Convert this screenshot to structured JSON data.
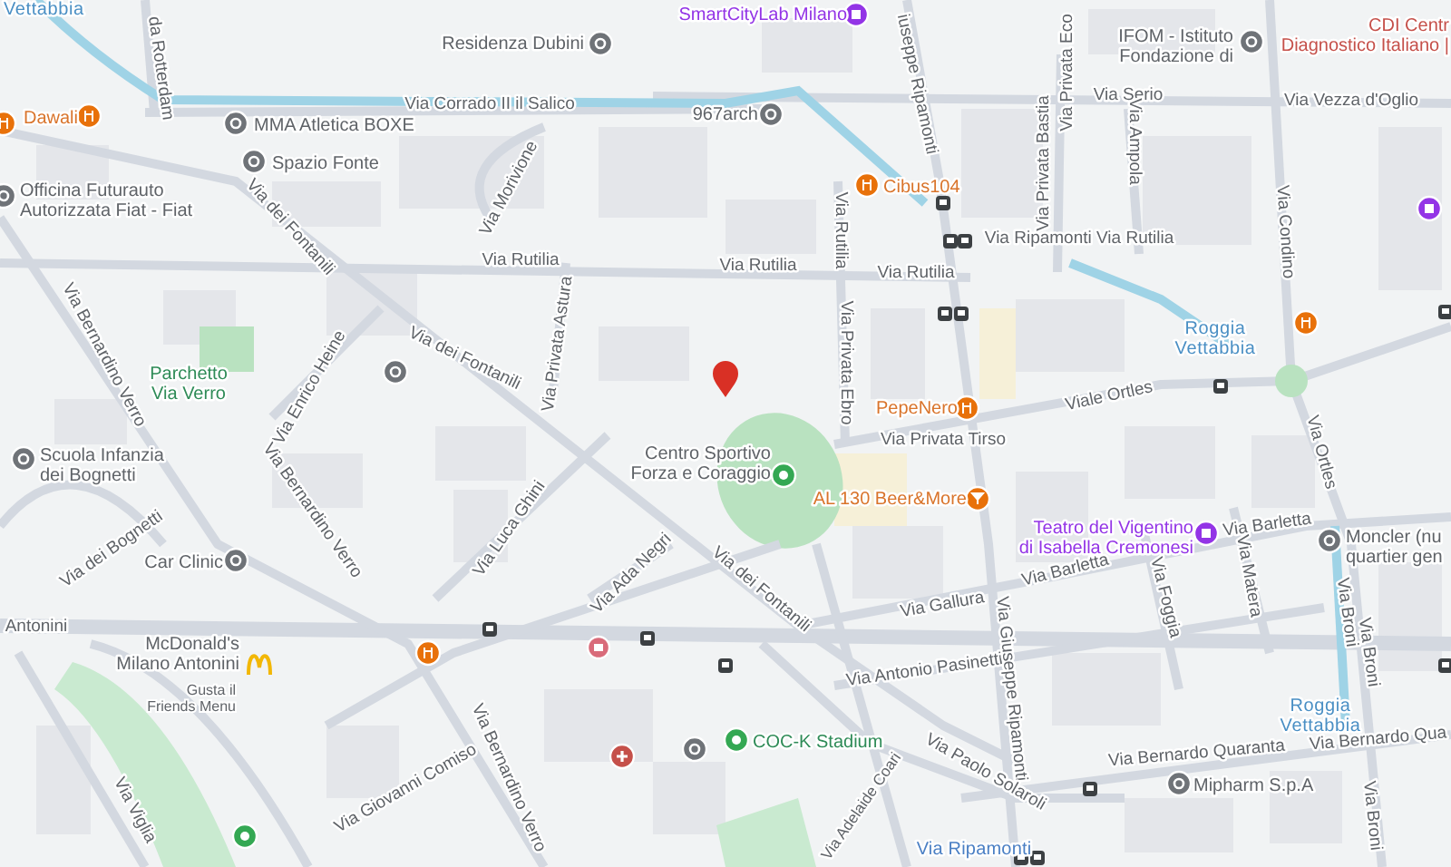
{
  "streets": [
    {
      "name": "da Rotterdam"
    },
    {
      "name": "Via Corrado II il Salico"
    },
    {
      "name": "Via Serio"
    },
    {
      "name": "Via Vezza d'Oglio"
    },
    {
      "name": "iuseppe Ripamonti"
    },
    {
      "name": "Via Privata Eco"
    },
    {
      "name": "Via Privata Bastia"
    },
    {
      "name": "Via Ampola"
    },
    {
      "name": "Via Condino"
    },
    {
      "name": "Via Morivione"
    },
    {
      "name": "Via dei Fontanili"
    },
    {
      "name": "Via Rutilia"
    },
    {
      "name": "Via Rutilia"
    },
    {
      "name": "Via Rutilia"
    },
    {
      "name": "Via Rutilia"
    },
    {
      "name": "Via Ripamonti Via Rutilia"
    },
    {
      "name": "Via Privata Astura"
    },
    {
      "name": "Via Privata Ebro"
    },
    {
      "name": "Via dei Fontanili"
    },
    {
      "name": "Via Bernardino Verro"
    },
    {
      "name": "Via Enrico Heine"
    },
    {
      "name": "Viale Ortles"
    },
    {
      "name": "Via Privata Tirso"
    },
    {
      "name": "Via Ortles"
    },
    {
      "name": "Via dei Bognetti"
    },
    {
      "name": "Via Bernardino Verro"
    },
    {
      "name": "Via Luca Ghini"
    },
    {
      "name": "Via Ada Negri"
    },
    {
      "name": "Via dei Fontanili"
    },
    {
      "name": "Via Gallura"
    },
    {
      "name": "Via Barletta"
    },
    {
      "name": "Via Barletta"
    },
    {
      "name": "Via Foggia"
    },
    {
      "name": "Via Matera"
    },
    {
      "name": "Via Broni"
    },
    {
      "name": "Via Broni"
    },
    {
      "name": "Antonini"
    },
    {
      "name": "Via Antonio Pasinetti"
    },
    {
      "name": "Via Giuseppe Ripamonti"
    },
    {
      "name": "Via Giovanni Comiso"
    },
    {
      "name": "Via Bernardino Verro"
    },
    {
      "name": "Via Paolo Solaroli"
    },
    {
      "name": "Via Bernardo Quaranta"
    },
    {
      "name": "Via Bernardo Qua"
    },
    {
      "name": "Via Broni"
    },
    {
      "name": "Via Adelaide Coari"
    },
    {
      "name": "Via Viglia"
    }
  ],
  "places": [
    {
      "lines": [
        "Vettabbia"
      ],
      "kind": "water",
      "color": "#4a8fc4"
    },
    {
      "lines": [
        "Residenza Dubini"
      ],
      "kind": "poi",
      "color": "#5f6368"
    },
    {
      "lines": [
        "SmartCityLab Milano"
      ],
      "kind": "culture",
      "color": "#9334e6"
    },
    {
      "lines": [
        "IFOM - Istituto",
        "Fondazione di"
      ],
      "kind": "poi",
      "color": "#5f6368"
    },
    {
      "lines": [
        "CDI Centr",
        "Diagnostico Italiano |"
      ],
      "kind": "medical",
      "color": "#c5504a"
    },
    {
      "lines": [
        "Dawali"
      ],
      "kind": "restaurant",
      "color": "#d9742b"
    },
    {
      "lines": [
        "MMA Atletica BOXE"
      ],
      "kind": "poi",
      "color": "#5f6368"
    },
    {
      "lines": [
        "967arch"
      ],
      "kind": "poi",
      "color": "#5f6368"
    },
    {
      "lines": [
        "Spazio Fonte"
      ],
      "kind": "poi",
      "color": "#5f6368"
    },
    {
      "lines": [
        "Cibus104"
      ],
      "kind": "restaurant",
      "color": "#d9742b"
    },
    {
      "lines": [
        "Officina Futurauto",
        "Autorizzata Fiat - Fiat"
      ],
      "kind": "poi",
      "color": "#5f6368"
    },
    {
      "lines": [
        "Parchetto",
        "Via Verro"
      ],
      "kind": "park",
      "color": "#2e8b57"
    },
    {
      "lines": [
        "Roggia",
        "Vettabbia"
      ],
      "kind": "water",
      "color": "#4a8fc4"
    },
    {
      "lines": [
        "PepeNero"
      ],
      "kind": "restaurant",
      "color": "#d9742b"
    },
    {
      "lines": [
        "Centro Sportivo",
        "Forza e Coraggio"
      ],
      "kind": "park",
      "color": "#5f6368"
    },
    {
      "lines": [
        "AL 130 Beer&More"
      ],
      "kind": "bar",
      "color": "#d9742b"
    },
    {
      "lines": [
        "Scuola Infanzia",
        "dei Bognetti"
      ],
      "kind": "poi",
      "color": "#5f6368"
    },
    {
      "lines": [
        "Car Clinic"
      ],
      "kind": "poi",
      "color": "#5f6368"
    },
    {
      "lines": [
        "Teatro del Vigentino",
        "di Isabella Cremonesi"
      ],
      "kind": "culture",
      "color": "#9334e6"
    },
    {
      "lines": [
        "Moncler (nu",
        "quartier gen"
      ],
      "kind": "poi",
      "color": "#5f6368"
    },
    {
      "lines": [
        "McDonald's",
        "Milano Antonini"
      ],
      "sub": [
        "Gusta il",
        "Friends Menu"
      ],
      "kind": "fastfood",
      "color": "#5f6368"
    },
    {
      "lines": [
        "COC-K Stadium"
      ],
      "kind": "park",
      "color": "#2e8b57"
    },
    {
      "lines": [
        "Roggia",
        "Vettabbia"
      ],
      "kind": "water",
      "color": "#4a8fc4"
    },
    {
      "lines": [
        "Mipharm S.p.A"
      ],
      "kind": "poi",
      "color": "#5f6368"
    },
    {
      "lines": [
        "Via Ripamonti"
      ],
      "kind": "transit",
      "color": "#4a7fc4"
    }
  ]
}
